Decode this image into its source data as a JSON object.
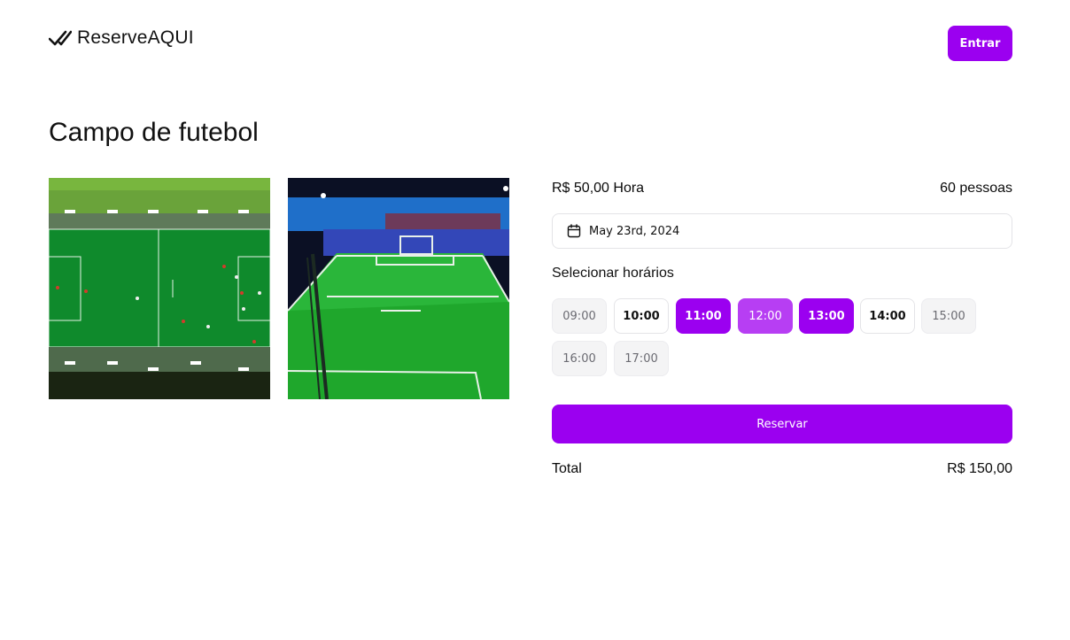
{
  "header": {
    "logo_text": "ReserveAQUI",
    "login_label": "Entrar"
  },
  "page": {
    "title": "Campo de futebol"
  },
  "gallery": {
    "images": [
      "aerial-view-football-field",
      "perspective-view-football-court"
    ]
  },
  "booking": {
    "price": "R$ 50,00 Hora",
    "capacity": "60 pessoas",
    "date": "May 23rd, 2024",
    "slots_label": "Selecionar horários",
    "slots": [
      {
        "time": "09:00",
        "state": "disabled"
      },
      {
        "time": "10:00",
        "state": "available"
      },
      {
        "time": "11:00",
        "state": "selected"
      },
      {
        "time": "12:00",
        "state": "hover"
      },
      {
        "time": "13:00",
        "state": "selected"
      },
      {
        "time": "14:00",
        "state": "available"
      },
      {
        "time": "15:00",
        "state": "disabled"
      },
      {
        "time": "16:00",
        "state": "disabled"
      },
      {
        "time": "17:00",
        "state": "disabled"
      }
    ],
    "reserve_label": "Reservar",
    "total_label": "Total",
    "total_value": "R$ 150,00"
  },
  "colors": {
    "accent": "#9b00f0",
    "accent_hover": "#b73ef3"
  },
  "icons": {
    "logo": "double-check-icon",
    "date": "calendar-icon"
  }
}
